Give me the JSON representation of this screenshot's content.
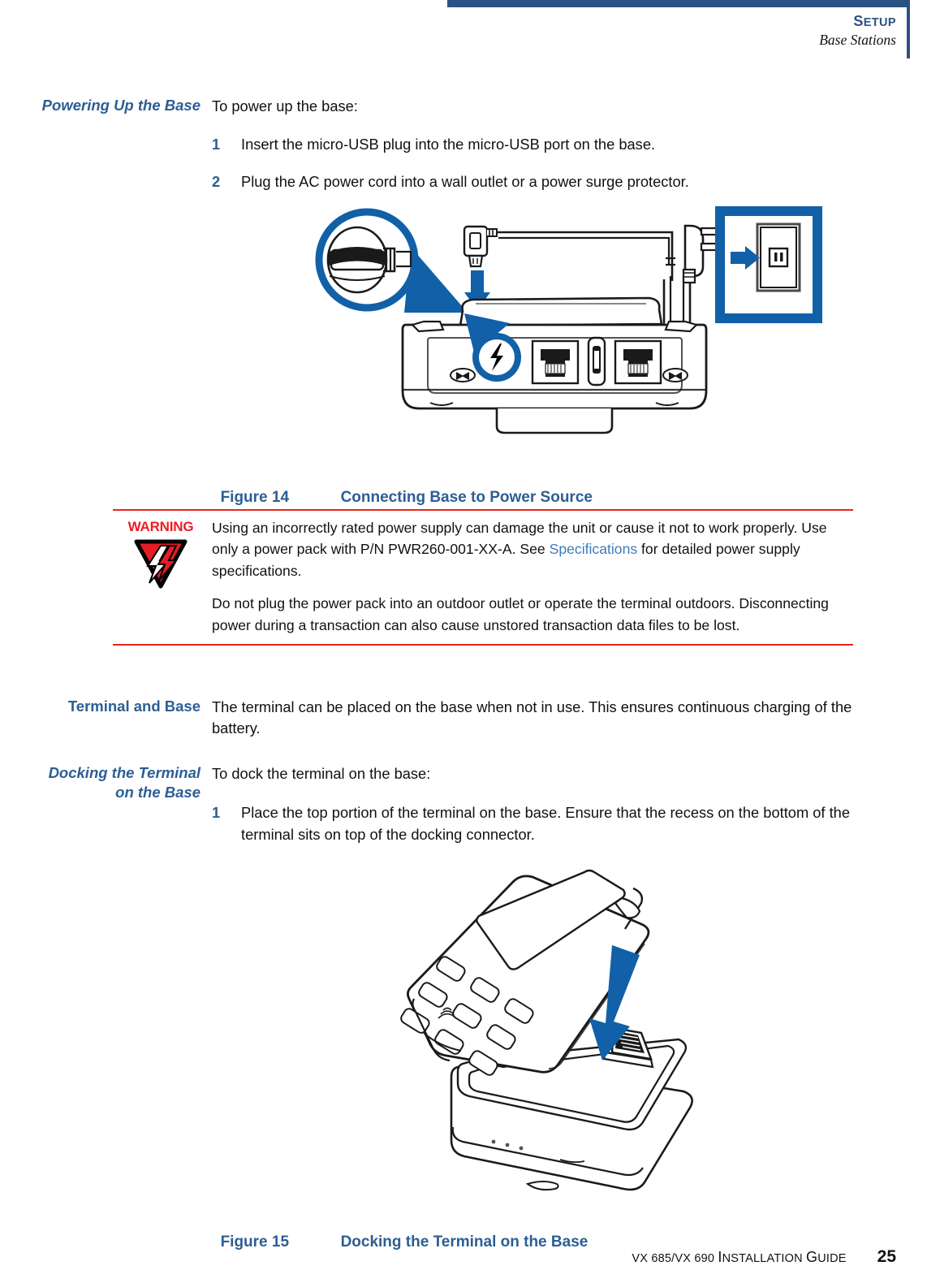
{
  "header": {
    "section_small_caps_first": "S",
    "section_rest": "ETUP",
    "section_full": "SETUP",
    "subtitle": "Base Stations",
    "accent_color": "#2C5183"
  },
  "sections": [
    {
      "heading": "Powering Up the Base",
      "style": "italic",
      "intro": "To power up the base:",
      "steps": [
        {
          "num": "1",
          "text": "Insert the micro-USB plug into the micro-USB port on the base."
        },
        {
          "num": "2",
          "text": "Plug the AC power cord into a wall outlet or a power surge protector."
        }
      ]
    },
    {
      "heading": "Terminal and Base",
      "style": "regular",
      "intro": "The terminal can be placed on the base when not in use. This ensures continuous charging of the battery."
    },
    {
      "heading_line1": "Docking the Terminal",
      "heading_line2": "on the Base",
      "style": "italic",
      "intro": "To dock the terminal on the base:",
      "steps": [
        {
          "num": "1",
          "text": "Place the top portion of the terminal on the base. Ensure that the recess on the bottom of the terminal sits on top of the docking connector."
        }
      ]
    }
  ],
  "figures": [
    {
      "number": "Figure 14",
      "title": "Connecting Base to Power Source",
      "alt": "Base station rear view with micro-USB plug, AC power cord and wall outlet"
    },
    {
      "number": "Figure 15",
      "title": "Docking the Terminal on the Base",
      "alt": "Terminal being lowered onto the base cradle docking connector"
    }
  ],
  "warning": {
    "label": "WARNING",
    "paragraph1_before_link": "Using an incorrectly rated power supply can damage the unit or cause it not to work properly. Use only a power pack with P/N PWR260-001-XX-A. See ",
    "link_text": "Specifications",
    "paragraph1_after_link": " for detailed power supply specifications.",
    "paragraph2": "Do not plug the power pack into an outdoor outlet or operate the terminal outdoors. Disconnecting power during a transaction can also cause unstored transaction data files to be lost.",
    "rule_color": "#E8251C",
    "label_color": "#ED1C24",
    "link_color": "#3E7CB8"
  },
  "footer": {
    "guide_title": "VX 685/VX 690 INSTALLATION GUIDE",
    "page_number": "25"
  },
  "colors": {
    "heading_blue": "#2C5E94",
    "illustration_blue": "#1160A8",
    "warning_red": "#E31E24"
  }
}
